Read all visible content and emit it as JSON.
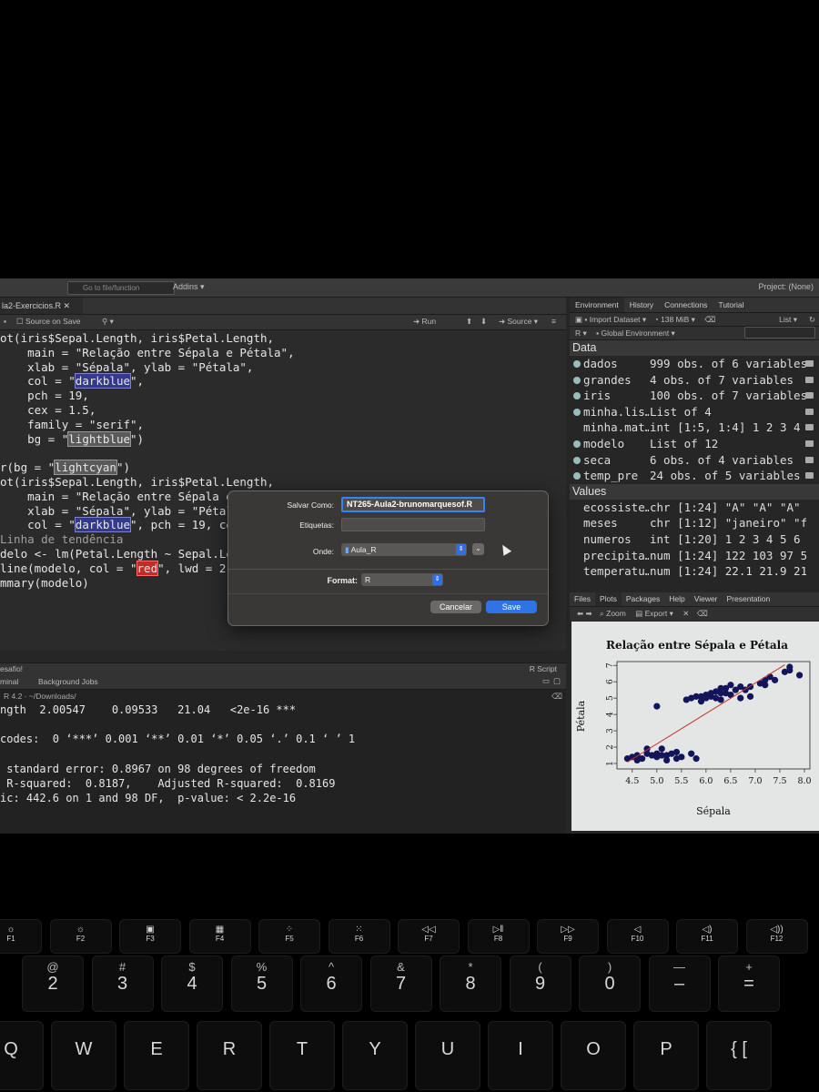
{
  "toolbar": {
    "goto_placeholder": "Go to file/function",
    "addins": "Addins",
    "project": "Project: (None)"
  },
  "source": {
    "tab_label": "la2-Exercicios.R",
    "source_on_save": "Source on Save",
    "run": "Run",
    "source": "Source",
    "status_left": "esafio!",
    "status_right": "R Script"
  },
  "code_lines": [
    "ot(iris$Sepal.Length, iris$Petal.Length,",
    "    main = \"Relação entre Sépala e Pétala\",",
    "    xlab = \"Sépala\", ylab = \"Pétala\",",
    "    col = \"darkblue\",",
    "    pch = 19,",
    "    cex = 1.5,",
    "    family = \"serif\",",
    "    bg = \"lightblue\")",
    "",
    "r(bg = \"lightcyan\")",
    "ot(iris$Sepal.Length, iris$Petal.Length,",
    "    main = \"Relação entre Sépala e Pétala\",",
    "    xlab = \"Sépala\", ylab = \"Pétala\",",
    "    col = \"darkblue\", pch = 19, cex = 1.",
    "Linha de tendência",
    "delo <- lm(Petal.Length ~ Sepal.Length",
    "line(modelo, col = \"red\", lwd = 2)",
    "mmary(modelo)"
  ],
  "console": {
    "tabs": [
      "minal",
      "Background Jobs"
    ],
    "path": "~/Downloads/",
    "lines": [
      "ngth  2.00547    0.09533   21.04   <2e-16 ***",
      "",
      "codes:  0 ‘***’ 0.001 ‘**’ 0.01 ‘*’ 0.05 ‘.’ 0.1 ‘ ’ 1",
      "",
      " standard error: 0.8967 on 98 degrees of freedom",
      " R-squared:  0.8187,    Adjusted R-squared:  0.8169",
      "ic: 442.6 on 1 and 98 DF,  p-value: < 2.2e-16"
    ]
  },
  "environment": {
    "tabs": [
      "Environment",
      "History",
      "Connections",
      "Tutorial"
    ],
    "import_dataset": "Import Dataset",
    "memory": "138 MiB",
    "list_view": "List",
    "language": "R",
    "scope": "Global Environment",
    "data_header": "Data",
    "data": [
      {
        "name": "dados",
        "value": "999 obs. of 6 variables"
      },
      {
        "name": "grandes",
        "value": "4 obs. of 7 variables"
      },
      {
        "name": "iris",
        "value": "100 obs. of 7 variables"
      },
      {
        "name": "minha.lis…",
        "value": "List of  4"
      },
      {
        "name": "minha.mat…",
        "value": "int [1:5, 1:4] 1 2 3 4 5…"
      },
      {
        "name": "modelo",
        "value": "List of  12"
      },
      {
        "name": "seca",
        "value": "6 obs. of 4 variables"
      },
      {
        "name": "temp_pre",
        "value": "24 obs. of 5 variables"
      }
    ],
    "values_header": "Values",
    "values": [
      {
        "name": "ecossiste…",
        "value": "chr [1:24] \"A\" \"A\" \"A\" \"A\"…"
      },
      {
        "name": "meses",
        "value": "chr [1:12] \"janeiro\" \"feve…"
      },
      {
        "name": "numeros",
        "value": "int [1:20] 1 2 3 4 5 6 7 8…"
      },
      {
        "name": "precipita…",
        "value": "num [1:24] 122 103 97 56 4…"
      },
      {
        "name": "temperatu…",
        "value": "num [1:24] 22.1 21.9 21.7 …"
      }
    ]
  },
  "files_pane": {
    "tabs": [
      "Files",
      "Plots",
      "Packages",
      "Help",
      "Viewer",
      "Presentation"
    ],
    "zoom": "Zoom",
    "export": "Export"
  },
  "chart_data": {
    "type": "scatter",
    "title": "Relação entre Sépala e Pétala",
    "xlabel": "Sépala",
    "ylabel": "Pétala",
    "xlim": [
      4.3,
      8.0
    ],
    "ylim": [
      1.0,
      6.9
    ],
    "xticks": [
      "4.5",
      "5.0",
      "5.5",
      "6.0",
      "6.5",
      "7.0",
      "7.5",
      "8.0"
    ],
    "yticks": [
      "1",
      "2",
      "3",
      "4",
      "5",
      "6",
      "7"
    ],
    "point_color": "#14145a",
    "line_color": "#c0392b",
    "regression": {
      "intercept": -7.1,
      "slope": 1.86
    },
    "points": [
      [
        4.4,
        1.3
      ],
      [
        4.5,
        1.4
      ],
      [
        4.6,
        1.5
      ],
      [
        4.7,
        1.3
      ],
      [
        4.8,
        1.6
      ],
      [
        4.9,
        1.5
      ],
      [
        5.0,
        1.6
      ],
      [
        5.0,
        1.4
      ],
      [
        5.1,
        1.5
      ],
      [
        5.1,
        1.9
      ],
      [
        5.2,
        1.5
      ],
      [
        5.3,
        1.6
      ],
      [
        5.4,
        1.7
      ],
      [
        5.4,
        1.3
      ],
      [
        5.5,
        1.4
      ],
      [
        5.7,
        1.6
      ],
      [
        5.8,
        1.3
      ],
      [
        4.6,
        1.2
      ],
      [
        4.8,
        1.9
      ],
      [
        5.2,
        1.2
      ],
      [
        5.0,
        4.5
      ],
      [
        5.6,
        4.9
      ],
      [
        5.7,
        5.0
      ],
      [
        5.8,
        5.1
      ],
      [
        5.9,
        4.8
      ],
      [
        6.0,
        5.0
      ],
      [
        6.1,
        5.1
      ],
      [
        6.1,
        5.3
      ],
      [
        6.2,
        5.4
      ],
      [
        6.3,
        5.6
      ],
      [
        6.3,
        4.9
      ],
      [
        6.4,
        5.3
      ],
      [
        6.4,
        5.6
      ],
      [
        6.5,
        5.2
      ],
      [
        6.5,
        5.8
      ],
      [
        6.6,
        5.5
      ],
      [
        6.7,
        5.7
      ],
      [
        6.7,
        5.0
      ],
      [
        6.8,
        5.5
      ],
      [
        6.9,
        5.7
      ],
      [
        6.9,
        5.1
      ],
      [
        7.1,
        5.9
      ],
      [
        7.2,
        6.1
      ],
      [
        7.2,
        5.8
      ],
      [
        7.3,
        6.3
      ],
      [
        7.4,
        6.1
      ],
      [
        7.6,
        6.6
      ],
      [
        7.7,
        6.7
      ],
      [
        7.7,
        6.9
      ],
      [
        7.9,
        6.4
      ],
      [
        6.0,
        5.2
      ],
      [
        5.9,
        5.1
      ],
      [
        6.2,
        5.0
      ],
      [
        6.3,
        5.3
      ]
    ]
  },
  "dialog": {
    "save_as_label": "Salvar Como:",
    "save_as_value": "NT265-Aula2-brunomarquesof.R",
    "tags_label": "Etiquetas:",
    "where_label": "Onde:",
    "where_value": "Aula_R",
    "format_label": "Format:",
    "format_value": "R",
    "cancel": "Cancelar",
    "save": "Save"
  },
  "keyboard": {
    "fkeys": [
      {
        "label": "F1",
        "glyph": "☼"
      },
      {
        "label": "F2",
        "glyph": "☼"
      },
      {
        "label": "F3",
        "glyph": "▣"
      },
      {
        "label": "F4",
        "glyph": "▦"
      },
      {
        "label": "F5",
        "glyph": "⁘"
      },
      {
        "label": "F6",
        "glyph": "⁙"
      },
      {
        "label": "F7",
        "glyph": "◁◁"
      },
      {
        "label": "F8",
        "glyph": "▷‖"
      },
      {
        "label": "F9",
        "glyph": "▷▷"
      },
      {
        "label": "F10",
        "glyph": "◁"
      },
      {
        "label": "F11",
        "glyph": "◁)"
      },
      {
        "label": "F12",
        "glyph": "◁))"
      }
    ],
    "numkeys": [
      {
        "label": "2",
        "sym": "@"
      },
      {
        "label": "3",
        "sym": "#"
      },
      {
        "label": "4",
        "sym": "$"
      },
      {
        "label": "5",
        "sym": "%"
      },
      {
        "label": "6",
        "sym": "^"
      },
      {
        "label": "7",
        "sym": "&"
      },
      {
        "label": "8",
        "sym": "*"
      },
      {
        "label": "9",
        "sym": "("
      },
      {
        "label": "0",
        "sym": ")"
      },
      {
        "label": "–",
        "sym": "—"
      },
      {
        "label": "=",
        "sym": "+"
      }
    ],
    "letters": [
      "Q",
      "W",
      "E",
      "R",
      "T",
      "Y",
      "U",
      "I",
      "O",
      "P",
      "{ ["
    ]
  }
}
